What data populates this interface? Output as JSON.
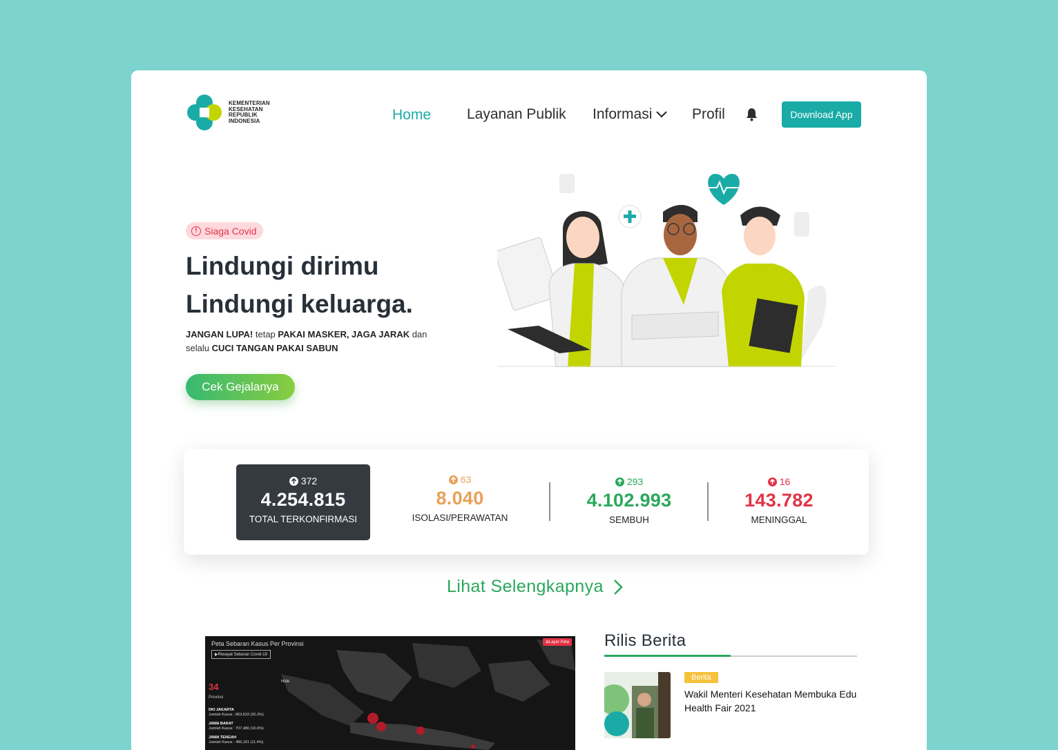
{
  "brand": {
    "logo_lines": [
      "KEMENTERIAN",
      "KESEHATAN",
      "REPUBLIK",
      "INDONESIA"
    ],
    "colors": {
      "teal": "#1aaba7",
      "lime": "#c3d500",
      "green": "#2aa85b",
      "red": "#e23346",
      "orange": "#e8a15a",
      "dark": "#343a40",
      "background": "#7dd4cf"
    }
  },
  "nav": {
    "items": [
      {
        "label": "Home",
        "active": true
      },
      {
        "label": "Layanan Publik"
      },
      {
        "label": "Informasi",
        "icon": "chevron-down-icon"
      },
      {
        "label": "Profil"
      }
    ],
    "bell_icon": "bell-icon",
    "download_label": "Download App"
  },
  "hero": {
    "badge": "Siaga Covid",
    "title_line1": "Lindungi dirimu",
    "title_line2": "Lindungi keluarga.",
    "sub": {
      "b1": "JANGAN LUPA!",
      "t1": " tetap ",
      "b2": "PAKAI MASKER, JAGA JARAK",
      "t2": " dan selalu ",
      "b3": "CUCI TANGAN PAKAI SABUN"
    },
    "cta": "Cek Gejalanya"
  },
  "stats": [
    {
      "delta": "372",
      "value": "4.254.815",
      "label": "TOTAL TERKONFIRMASI",
      "color": "#ffffff"
    },
    {
      "delta": "63",
      "value": "8.040",
      "label": "ISOLASI/PERAWATAN",
      "color": "#e8a15a"
    },
    {
      "delta": "293",
      "value": "4.102.993",
      "label": "SEMBUH",
      "color": "#2aa85b"
    },
    {
      "delta": "16",
      "value": "143.782",
      "label": "MENINGGAL",
      "color": "#e23346"
    }
  ],
  "more_link": "Lihat Selengkapnya",
  "map": {
    "title": "Peta Sebaran Kasus Per Provinsi",
    "history_btn": "▶Riwayat Sebaran Covid-19",
    "layer_btn": "⊕Layer Peta",
    "province_count": "34",
    "province_label": "Provinsi",
    "hide": "Hide",
    "list": [
      {
        "name": "DKI JAKARTA",
        "cases": "Jumlah Kasus : 863,633 (20.3%)"
      },
      {
        "name": "JAWA BARAT",
        "cases": "Jumlah Kasus : 707,486 (16.6%)"
      },
      {
        "name": "JAWA TENGAH",
        "cases": "Jumlah Kasus : 486,161 (11.4%)"
      }
    ]
  },
  "news": {
    "section_title": "Rilis Berita",
    "items": [
      {
        "tag": "Berita",
        "headline": "Wakil Menteri Kesehatan Membuka Edu Health Fair 2021"
      }
    ]
  }
}
